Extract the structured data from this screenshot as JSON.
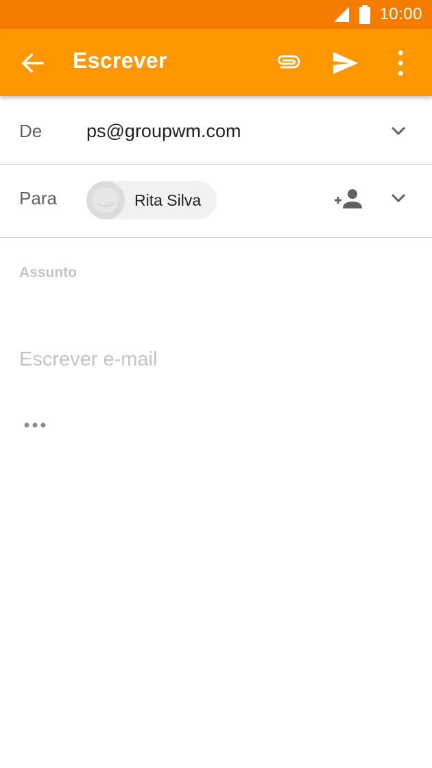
{
  "status_bar": {
    "time": "10:00",
    "icons": [
      "signal-icon",
      "battery-icon"
    ]
  },
  "app_bar": {
    "title": "Escrever",
    "icons": [
      "back-arrow-icon",
      "paperclip-icon",
      "send-icon",
      "more-vert-icon"
    ],
    "color": "#ff9800"
  },
  "from_row": {
    "label": "De",
    "value": "ps@groupwm.com"
  },
  "to_row": {
    "label": "Para",
    "recipient": "Rita Silva"
  },
  "subject": {
    "placeholder": "Assunto"
  },
  "compose": {
    "placeholder": "Escrever e-mail"
  },
  "colors": {
    "status_bar": "#f57c00",
    "app_bar": "#ff9800"
  }
}
